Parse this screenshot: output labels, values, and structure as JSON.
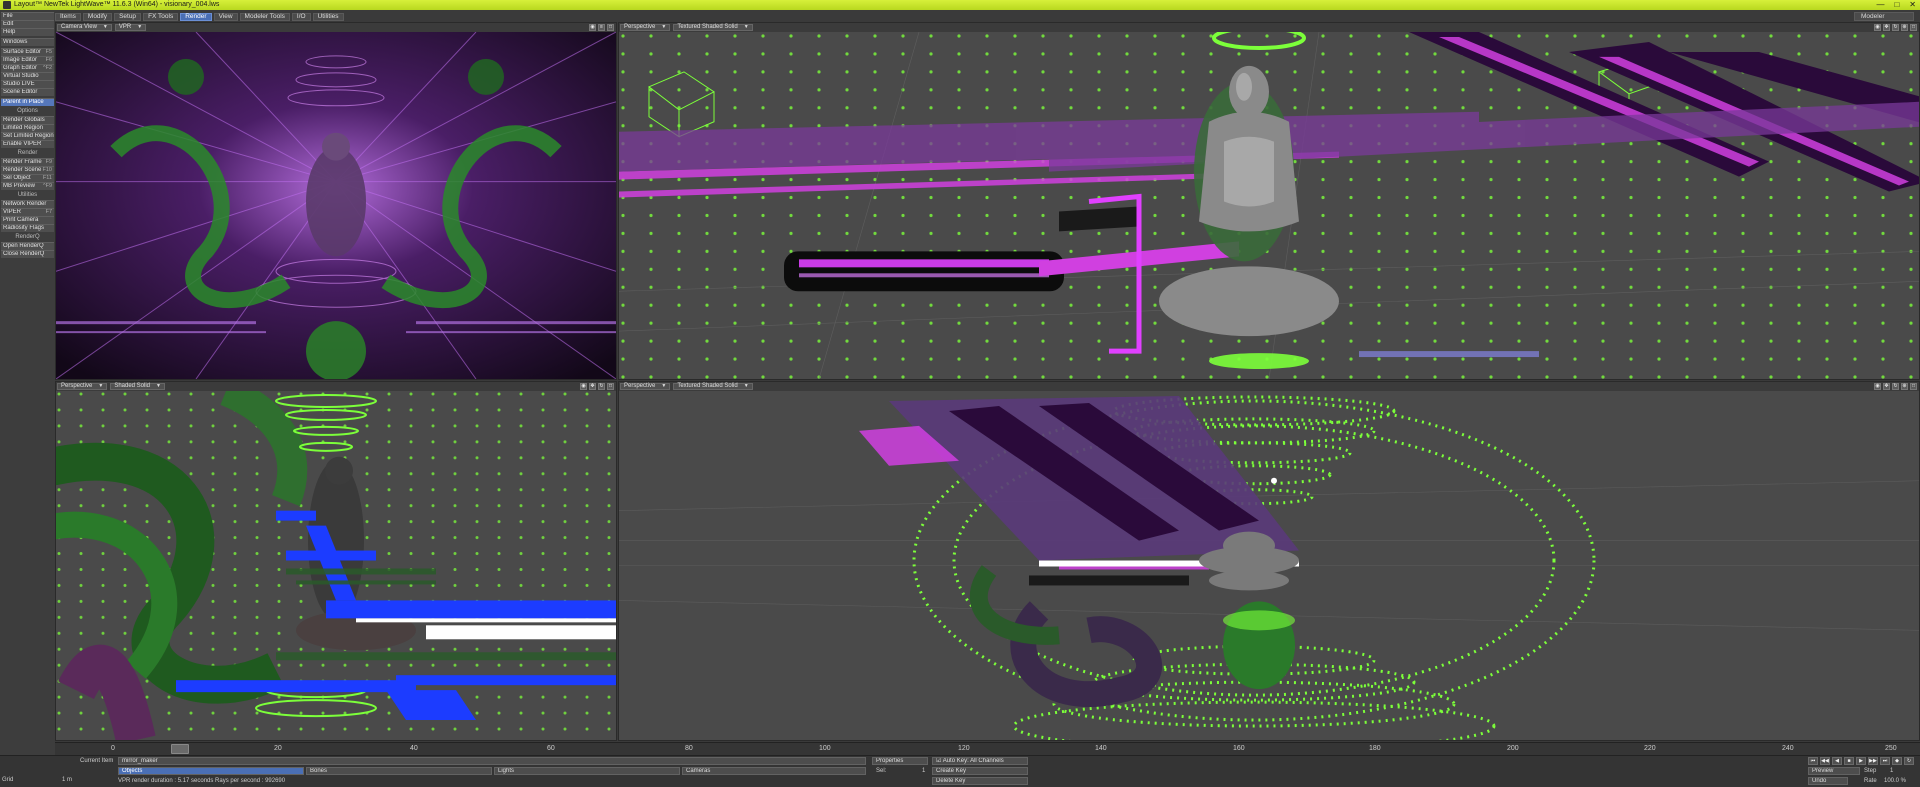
{
  "window": {
    "title": "Layout™ NewTek LightWave™ 11.6.3 (Win64) - visionary_004.lws",
    "minimize": "—",
    "maximize": "□",
    "close": "✕"
  },
  "menu_tabs": [
    "Items",
    "Modify",
    "Setup",
    "FX Tools",
    "Render",
    "View",
    "Modeler Tools",
    "I/O",
    "Utilities"
  ],
  "active_tab": "Render",
  "modeler_button": "Modeler",
  "toolbar": {
    "file": "File",
    "edit": "Edit",
    "help": "Help",
    "windows": "Windows",
    "surface_editor": "Surface Editor",
    "surface_editor_sc": "F5",
    "image_editor": "Image Editor",
    "image_editor_sc": "F6",
    "graph_editor": "Graph Editor",
    "graph_editor_sc": "^F2",
    "virtual_studio": "Virtual Studio",
    "studio_live": "Studio LIVE",
    "scene_editor": "Scene Editor",
    "parent_in_place": "Parent in Place",
    "options": "Options",
    "render_globals": "Render Globals",
    "limited_region": "Limited Region",
    "set_limited_region": "Set Limited Region",
    "enable_viper": "Enable VIPER",
    "render": "Render",
    "render_frame": "Render Frame",
    "render_frame_sc": "F9",
    "render_scene": "Render Scene",
    "render_scene_sc": "F10",
    "sel_object": "Sel Object",
    "sel_object_sc": "F11",
    "mb_preview": "MB Preview",
    "mb_preview_sc": "^F9",
    "utilities": "Utilities",
    "network_render": "Network Render",
    "viper": "VIPER",
    "viper_sc": "F7",
    "print_camera": "Print Camera",
    "radiosity_flags": "Radiosity Flags",
    "renderq": "RenderQ",
    "open_renderq": "Open RenderQ",
    "close_renderq": "Close RenderQ"
  },
  "viewports": {
    "top_left": {
      "view": "Camera View",
      "mode": "VPR"
    },
    "top_right": {
      "view": "Perspective",
      "mode": "Textured Shaded Solid"
    },
    "bottom_left": {
      "view": "Perspective",
      "mode": "Shaded Solid"
    },
    "bottom_right": {
      "view": "Perspective",
      "mode": "Textured Shaded Solid"
    }
  },
  "timeline": {
    "ticks": [
      "0",
      "20",
      "40",
      "60",
      "80",
      "100",
      "120",
      "140",
      "160",
      "180",
      "200",
      "220",
      "240",
      "250"
    ],
    "current_frame": "0"
  },
  "bottom": {
    "grid_label": "Grid",
    "grid_value": "1 m",
    "current_item_label": "Current Item",
    "current_item": "mirror_maker",
    "objects": "Objects",
    "bones": "Bones",
    "lights": "Lights",
    "cameras": "Cameras",
    "properties": "Properties",
    "sel_label": "Sel:",
    "sel_value": "1",
    "auto_key": "Auto Key: All Channels",
    "create_key": "Create Key",
    "delete_key": "Delete Key",
    "status": "VPR render duration : 5.17 seconds  Rays per second : 992690",
    "preview": "Preview",
    "undo": "Undo",
    "step_label": "Step",
    "step_value": "1",
    "rate_label": "Rate",
    "rate_value": "100.0 %"
  },
  "colors": {
    "title_bar": "#c6e22a",
    "accent": "#4a6fb5",
    "viewport_bg": "#4a4a4a",
    "point_green": "#7cff3a",
    "magenta": "#d040e0",
    "blue": "#1c3cff"
  },
  "icons": [
    "layout-icon",
    "camera-icon",
    "options-icon",
    "maximize-icon",
    "play-icon",
    "stop-icon",
    "key-icon"
  ]
}
